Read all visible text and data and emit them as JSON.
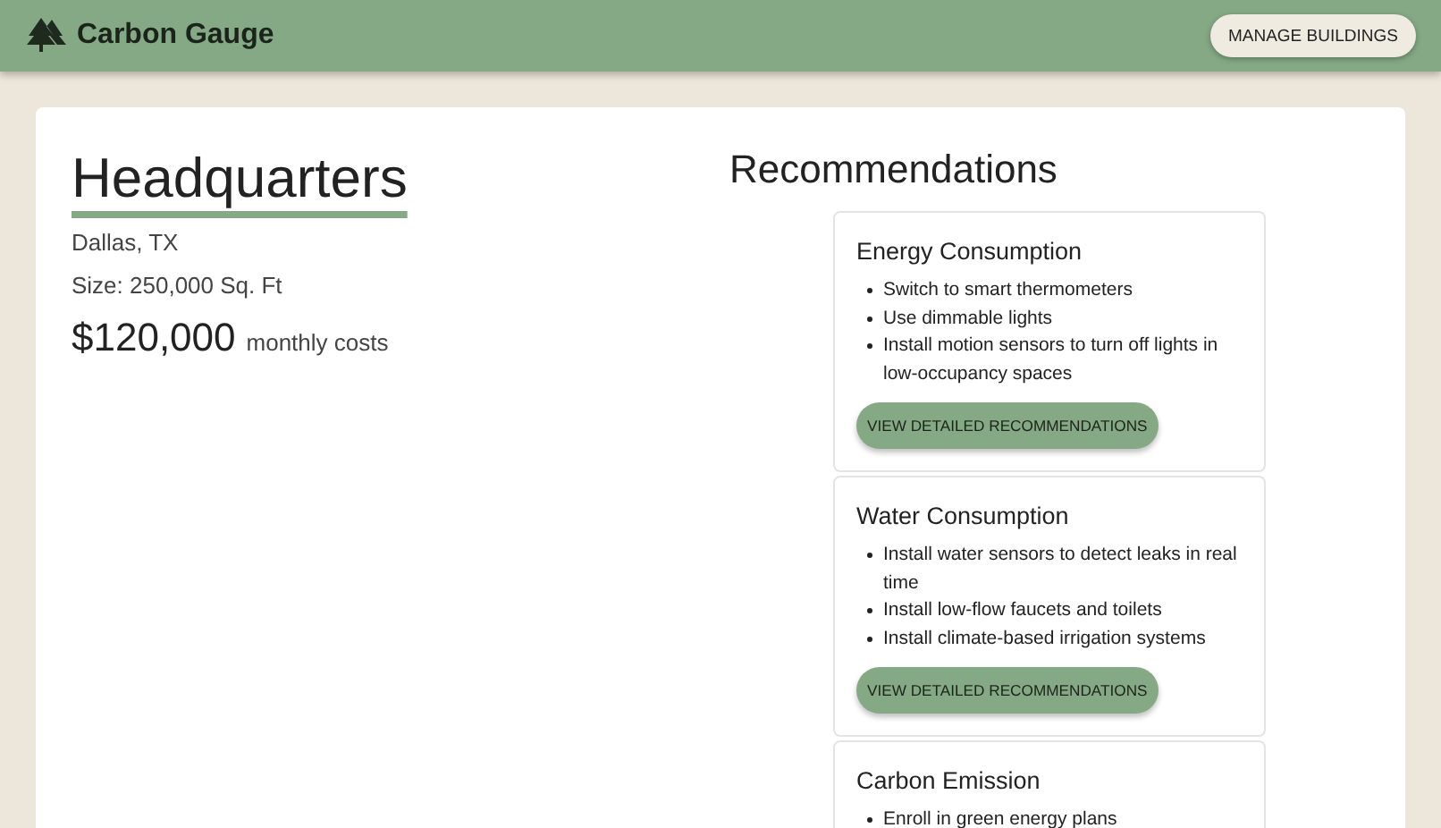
{
  "header": {
    "brand": "Carbon Gauge",
    "action": "MANAGE BUILDINGS"
  },
  "building": {
    "name": "Headquarters",
    "location": "Dallas, TX",
    "size": "Size: 250,000 Sq. Ft",
    "cost": "$120,000",
    "cost_label": "monthly costs"
  },
  "recommendations": {
    "title": "Recommendations",
    "cards": [
      {
        "title": "Energy Consumption",
        "items": [
          "Switch to smart thermometers",
          "Use dimmable lights",
          "Install motion sensors to turn off lights in low-occupancy spaces"
        ],
        "button": "VIEW DETAILED RECOMMENDATIONS"
      },
      {
        "title": "Water Consumption",
        "items": [
          "Install water sensors to detect leaks in real time",
          "Install low-flow faucets and toilets",
          "Install climate-based irrigation systems"
        ],
        "button": "VIEW DETAILED RECOMMENDATIONS"
      },
      {
        "title": "Carbon Emission",
        "items": [
          "Enroll in green energy plans"
        ]
      }
    ]
  }
}
